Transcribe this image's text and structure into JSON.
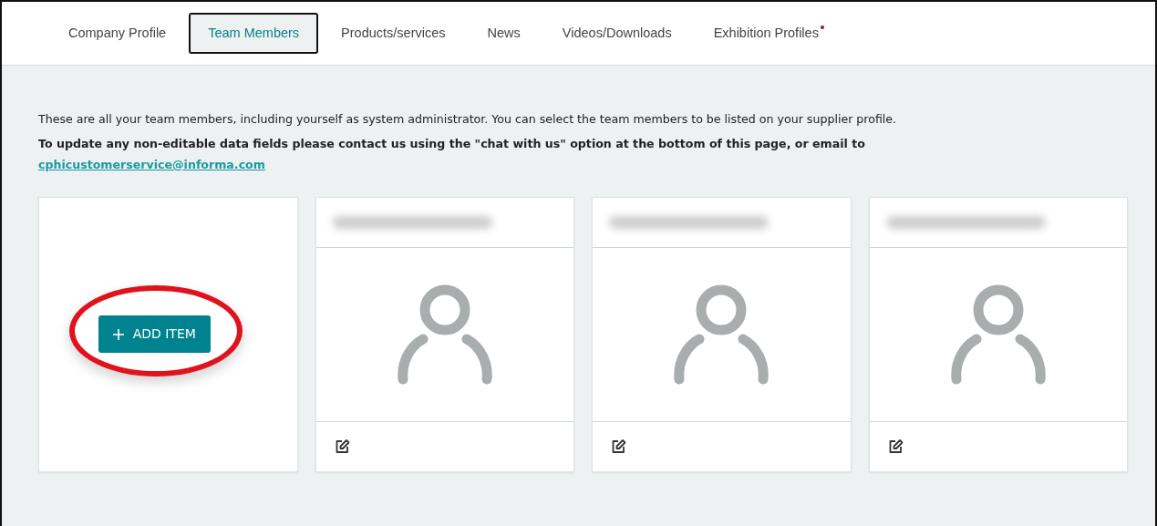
{
  "tabs": [
    {
      "label": "Company Profile",
      "selected": false,
      "notice": false
    },
    {
      "label": "Team Members",
      "selected": true,
      "notice": false
    },
    {
      "label": "Products/services",
      "selected": false,
      "notice": false
    },
    {
      "label": "News",
      "selected": false,
      "notice": false
    },
    {
      "label": "Videos/Downloads",
      "selected": false,
      "notice": false
    },
    {
      "label": "Exhibition Profiles",
      "selected": false,
      "notice": true
    }
  ],
  "intro": "These are all your team members, including yourself as system administrator. You can select the team members to be listed on your supplier profile.",
  "notice": "To update any non-editable data fields please contact us using the \"chat with us\" option at the bottom of this page, or email to",
  "email": "cphicustomerservice@informa.com",
  "add_button": {
    "label": "ADD ITEM",
    "highlighted": true
  },
  "members": [
    {
      "name_redacted": true
    },
    {
      "name_redacted": true
    },
    {
      "name_redacted": true
    }
  ]
}
